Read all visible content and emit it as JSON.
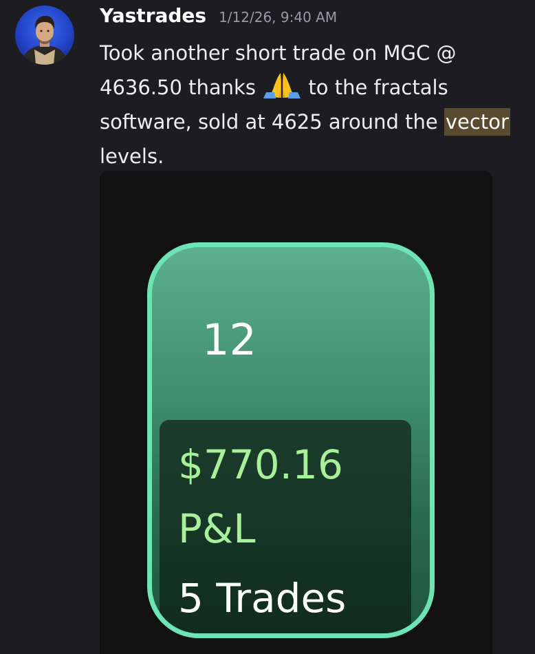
{
  "message": {
    "author": "Yastrades",
    "timestamp": "1/12/26, 9:40 AM",
    "text_part1": "Took another short trade on MGC @ 4636.50 thanks ",
    "emoji": "folded-hands-emoji",
    "text_part2": " to the fractals software, sold at 4625 around the ",
    "highlighted_word": "vector",
    "text_part3": " levels."
  },
  "attachment": {
    "day": "12",
    "pnl_value": "$770.16",
    "pnl_label": "P&L",
    "trades_count": "5 Trades"
  },
  "colors": {
    "background": "#1c1c21",
    "highlight": "#5a4a30",
    "widget_border": "#6ee3b5",
    "pnl_text": "#a8f09a"
  }
}
